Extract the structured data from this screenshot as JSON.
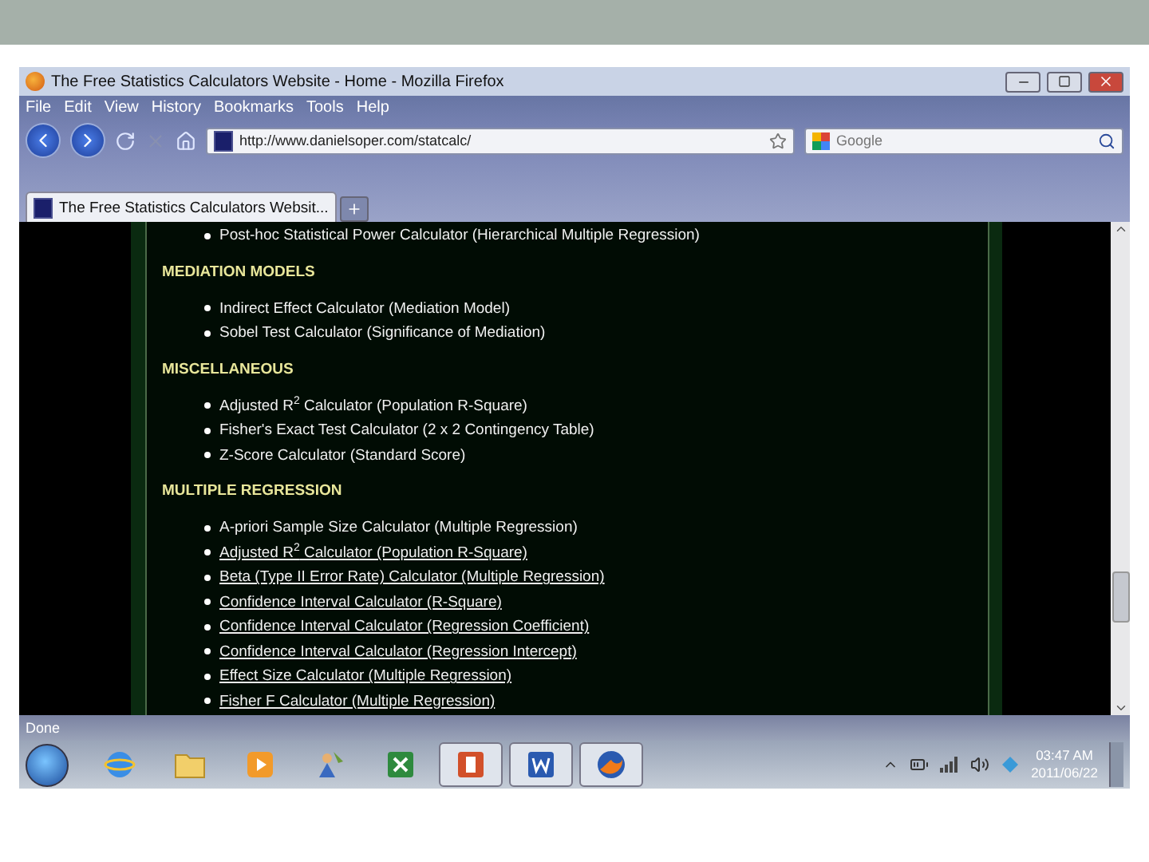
{
  "window": {
    "title": "The Free Statistics Calculators Website - Home - Mozilla Firefox"
  },
  "menu": [
    "File",
    "Edit",
    "View",
    "History",
    "Bookmarks",
    "Tools",
    "Help"
  ],
  "address_bar": {
    "value": "http://www.danielsoper.com/statcalc/"
  },
  "search": {
    "placeholder": "Google"
  },
  "tabs": [
    {
      "label": "The Free Statistics Calculators Websit...",
      "selected": true
    }
  ],
  "content": {
    "lead_items": [
      {
        "text": "Post-hoc Statistical Power Calculator (Hierarchical Multiple Regression)",
        "link": false
      }
    ],
    "sections": [
      {
        "heading": "MEDIATION MODELS",
        "items": [
          {
            "text": "Indirect Effect Calculator (Mediation Model)",
            "link": false
          },
          {
            "text": "Sobel Test Calculator (Significance of Mediation)",
            "link": false
          }
        ]
      },
      {
        "heading": "MISCELLANEOUS",
        "items": [
          {
            "text": "Adjusted R$^{2}$ Calculator (Population R-Square)",
            "link": false
          },
          {
            "text": "Fisher's Exact Test Calculator (2 x 2 Contingency Table)",
            "link": false
          },
          {
            "text": "Z-Score Calculator (Standard Score)",
            "link": false
          }
        ]
      },
      {
        "heading": "MULTIPLE REGRESSION",
        "items": [
          {
            "text": "A-priori Sample Size Calculator (Multiple Regression)",
            "link": false
          },
          {
            "text": "Adjusted R$^{2}$ Calculator (Population R-Square)",
            "link": true
          },
          {
            "text": "Beta (Type II Error Rate) Calculator (Multiple Regression)",
            "link": true
          },
          {
            "text": "Confidence Interval Calculator (R-Square)",
            "link": true
          },
          {
            "text": "Confidence Interval Calculator (Regression Coefficient)",
            "link": true
          },
          {
            "text": "Confidence Interval Calculator (Regression Intercept)",
            "link": true
          },
          {
            "text": "Effect Size Calculator (Multiple Regression)",
            "link": true
          },
          {
            "text": "Fisher F Calculator (Multiple Regression)",
            "link": true
          }
        ]
      }
    ]
  },
  "status_bar": {
    "text": "Done"
  },
  "taskbar": {
    "apps": [
      {
        "kind": "ie",
        "open": false
      },
      {
        "kind": "folder",
        "open": false
      },
      {
        "kind": "media",
        "open": false
      },
      {
        "kind": "tool",
        "open": false
      },
      {
        "kind": "excel",
        "open": false
      },
      {
        "kind": "powerpoint",
        "open": true
      },
      {
        "kind": "word",
        "open": true
      },
      {
        "kind": "firefox",
        "open": true
      }
    ],
    "clock": {
      "time": "03:47 AM",
      "date": "2011/06/22"
    }
  }
}
